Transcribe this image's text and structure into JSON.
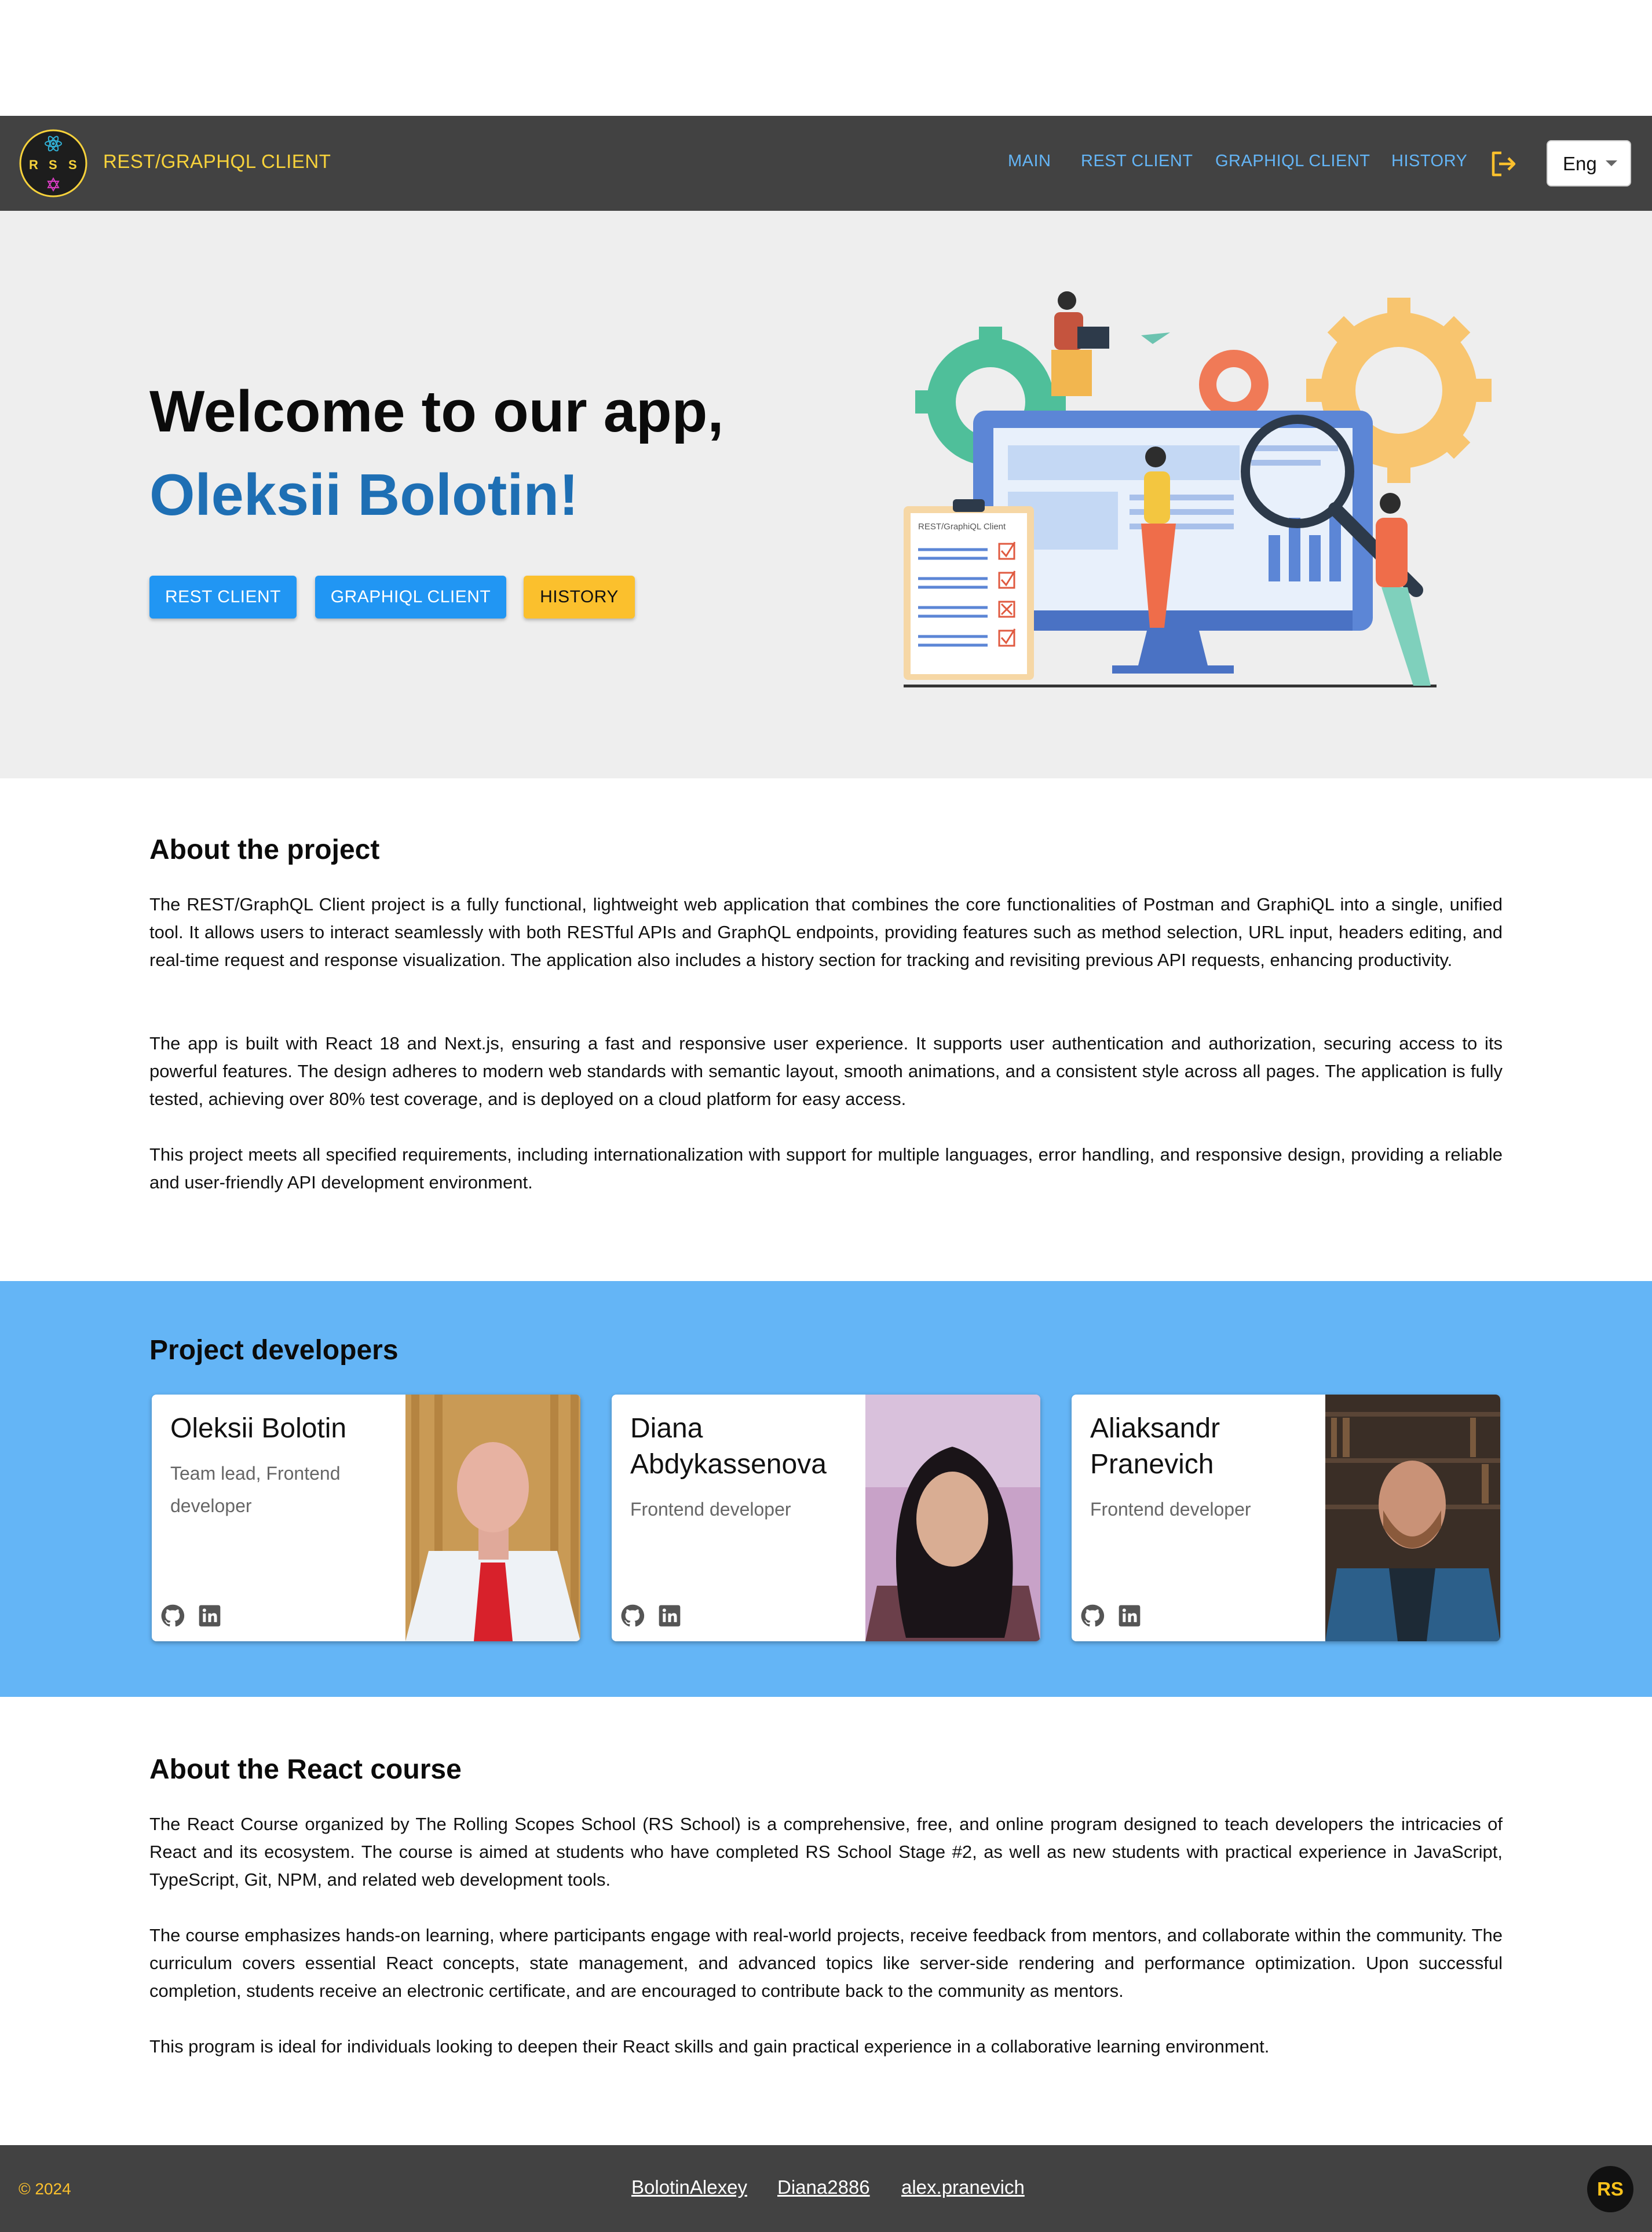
{
  "header": {
    "brand": "REST/GRAPHQL CLIENT",
    "logo_letters": [
      "R",
      "S",
      "S"
    ],
    "nav": [
      "MAIN",
      "REST CLIENT",
      "GRAPHIQL CLIENT",
      "HISTORY"
    ],
    "language": "Eng"
  },
  "hero": {
    "title": "Welcome to our app,",
    "name": "Oleksii Bolotin!",
    "buttons": [
      "REST CLIENT",
      "GRAPHIQL CLIENT",
      "HISTORY"
    ],
    "illustration_clipboard_label": "REST/GraphiQL Client"
  },
  "about_project": {
    "title": "About the project",
    "paragraphs": [
      "The REST/GraphQL Client project is a fully functional, lightweight web application that combines the core functionalities of Postman and GraphiQL into a single, unified tool. It allows users to interact seamlessly with both RESTful APIs and GraphQL endpoints, providing features such as method selection, URL input, headers editing, and real-time request and response visualization. The application also includes a history section for tracking and revisiting previous API requests, enhancing productivity.",
      "The app is built with React 18 and Next.js, ensuring a fast and responsive user experience. It supports user authentication and authorization, securing access to its powerful features. The design adheres to modern web standards with semantic layout, smooth animations, and a consistent style across all pages. The application is fully tested, achieving over 80% test coverage, and is deployed on a cloud platform for easy access.",
      "This project meets all specified requirements, including internationalization with support for multiple languages, error handling, and responsive design, providing a reliable and user-friendly API development environment."
    ]
  },
  "developers": {
    "title": "Project developers",
    "cards": [
      {
        "name": "Oleksii Bolotin",
        "role": "Team lead, Frontend developer"
      },
      {
        "name": "Diana Abdykassenova",
        "role": "Frontend developer"
      },
      {
        "name": "Aliaksandr Pranevich",
        "role": "Frontend developer"
      }
    ]
  },
  "about_course": {
    "title": "About the React course",
    "paragraphs": [
      "The React Course organized by The Rolling Scopes School (RS School) is a comprehensive, free, and online program designed to teach developers the intricacies of React and its ecosystem. The course is aimed at students who have completed RS School Stage #2, as well as new students with practical experience in JavaScript, TypeScript, Git, NPM, and related web development tools.",
      "The course emphasizes hands-on learning, where participants engage with real-world projects, receive feedback from mentors, and collaborate within the community. The curriculum covers essential React concepts, state management, and advanced topics like server-side rendering and performance optimization. Upon successful completion, students receive an electronic certificate, and are encouraged to contribute back to the community as mentors.",
      "This program is ideal for individuals looking to deepen their React skills and gain practical experience in a collaborative learning environment."
    ]
  },
  "footer": {
    "copyright": "© 2024",
    "links": [
      "BolotinAlexey",
      "Diana2886",
      "alex.pranevich"
    ],
    "badge": "RS"
  },
  "colors": {
    "header_bg": "#424242",
    "accent_yellow": "#fbc02d",
    "nav_blue": "#64b5f6",
    "button_blue": "#2196f3",
    "name_blue": "#1e6fb4",
    "developers_bg": "#64b5f6"
  }
}
